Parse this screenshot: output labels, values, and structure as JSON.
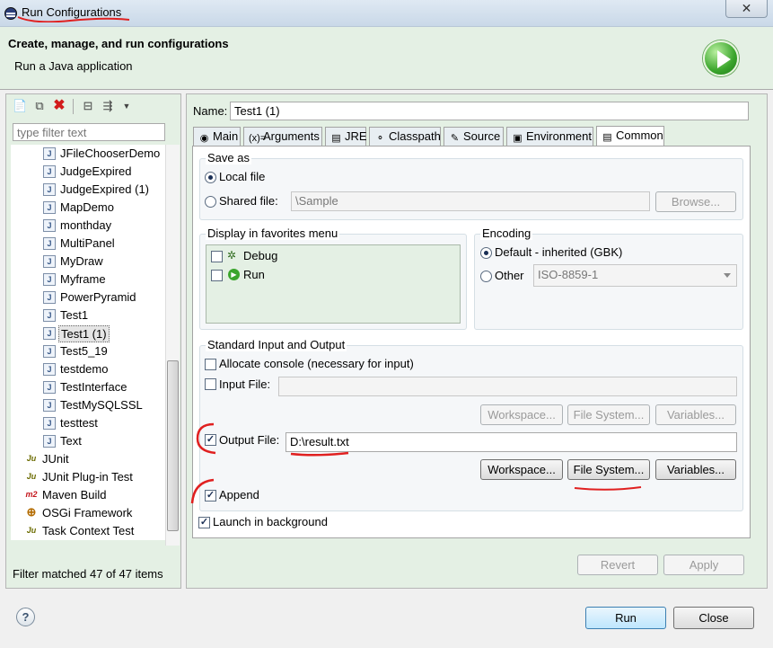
{
  "window": {
    "title": "Run Configurations",
    "close_glyph": "✕"
  },
  "header": {
    "title": "Create, manage, and run configurations",
    "subtitle": "Run a Java application"
  },
  "left": {
    "filter_placeholder": "type filter text",
    "tree": [
      {
        "label": "JFileChooserDemo",
        "icon": "java-class-icon",
        "glyph": "J",
        "indent": 1
      },
      {
        "label": "JudgeExpired",
        "icon": "java-class-icon",
        "glyph": "J",
        "indent": 1
      },
      {
        "label": "JudgeExpired (1)",
        "icon": "java-class-icon",
        "glyph": "J",
        "indent": 1
      },
      {
        "label": "MapDemo",
        "icon": "java-class-icon",
        "glyph": "J",
        "indent": 1
      },
      {
        "label": "monthday",
        "icon": "java-class-icon",
        "glyph": "J",
        "indent": 1
      },
      {
        "label": "MultiPanel",
        "icon": "java-class-icon",
        "glyph": "J",
        "indent": 1
      },
      {
        "label": "MyDraw",
        "icon": "java-class-icon",
        "glyph": "J",
        "indent": 1
      },
      {
        "label": "Myframe",
        "icon": "java-class-icon",
        "glyph": "J",
        "indent": 1
      },
      {
        "label": "PowerPyramid",
        "icon": "java-class-icon",
        "glyph": "J",
        "indent": 1
      },
      {
        "label": "Test1",
        "icon": "java-class-icon",
        "glyph": "J",
        "indent": 1
      },
      {
        "label": "Test1 (1)",
        "icon": "java-class-icon",
        "glyph": "J",
        "indent": 1,
        "selected": true
      },
      {
        "label": "Test5_19",
        "icon": "java-class-icon",
        "glyph": "J",
        "indent": 1
      },
      {
        "label": "testdemo",
        "icon": "java-class-icon",
        "glyph": "J",
        "indent": 1
      },
      {
        "label": "TestInterface",
        "icon": "java-class-icon",
        "glyph": "J",
        "indent": 1
      },
      {
        "label": "TestMySQLSSL",
        "icon": "java-class-icon",
        "glyph": "J",
        "indent": 1
      },
      {
        "label": "testtest",
        "icon": "java-class-icon",
        "glyph": "J",
        "indent": 1
      },
      {
        "label": "Text",
        "icon": "java-class-icon",
        "glyph": "J",
        "indent": 1
      },
      {
        "label": "JUnit",
        "icon": "junit-icon",
        "glyph": "Ju",
        "indent": 0
      },
      {
        "label": "JUnit Plug-in Test",
        "icon": "junit-plugin-icon",
        "glyph": "Ju",
        "indent": 0
      },
      {
        "label": "Maven Build",
        "icon": "maven-icon",
        "glyph": "m2",
        "indent": 0
      },
      {
        "label": "OSGi Framework",
        "icon": "osgi-icon",
        "glyph": "⊕",
        "indent": 0
      },
      {
        "label": "Task Context Test",
        "icon": "task-context-icon",
        "glyph": "Ju",
        "indent": 0
      }
    ],
    "status": "Filter matched 47 of 47 items"
  },
  "config": {
    "name_label": "Name:",
    "name_value": "Test1 (1)",
    "tabs": [
      {
        "label": "Main",
        "icon": "main-tab-icon",
        "glyph": "◉"
      },
      {
        "label": "Arguments",
        "icon": "arguments-tab-icon",
        "glyph": "(x)="
      },
      {
        "label": "JRE",
        "icon": "jre-tab-icon",
        "glyph": "▤"
      },
      {
        "label": "Classpath",
        "icon": "classpath-tab-icon",
        "glyph": "⚬"
      },
      {
        "label": "Source",
        "icon": "source-tab-icon",
        "glyph": "✎"
      },
      {
        "label": "Environment",
        "icon": "environment-tab-icon",
        "glyph": "▣"
      },
      {
        "label": "Common",
        "icon": "common-tab-icon",
        "glyph": "▤",
        "active": true
      }
    ]
  },
  "common": {
    "save_as": {
      "label": "Save as",
      "local": "Local file",
      "shared": "Shared file:",
      "shared_value": "\\Sample",
      "browse": "Browse..."
    },
    "favorites": {
      "label": "Display in favorites menu",
      "items": [
        {
          "label": "Debug",
          "icon": "debug-icon"
        },
        {
          "label": "Run",
          "icon": "run-icon"
        }
      ]
    },
    "encoding": {
      "label": "Encoding",
      "default": "Default - inherited (GBK)",
      "other": "Other",
      "other_value": "ISO-8859-1"
    },
    "stdio": {
      "label": "Standard Input and Output",
      "allocate": "Allocate console (necessary for input)",
      "input_label": "Input File:",
      "output_label": "Output File:",
      "output_value": "D:\\result.txt",
      "workspace": "Workspace...",
      "file_system": "File System...",
      "variables": "Variables...",
      "append": "Append"
    },
    "launch_bg": "Launch in background"
  },
  "buttons": {
    "revert": "Revert",
    "apply": "Apply",
    "run": "Run",
    "close": "Close",
    "help": "?"
  }
}
